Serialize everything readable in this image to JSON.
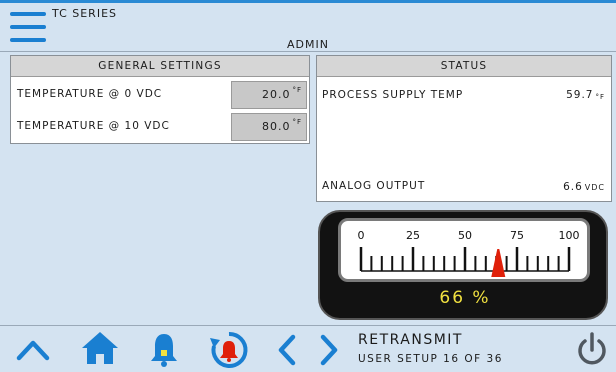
{
  "header": {
    "series_label": "TC SERIES",
    "user_level": "ADMIN",
    "menu_icon": "hamburger-menu-icon"
  },
  "general_settings": {
    "title": "GENERAL SETTINGS",
    "rows": [
      {
        "label": "TEMPERATURE @ 0 VDC",
        "value": "20.0",
        "unit": "°F"
      },
      {
        "label": "TEMPERATURE @ 10 VDC",
        "value": "80.0",
        "unit": "°F"
      }
    ]
  },
  "status": {
    "title": "STATUS",
    "rows": [
      {
        "label": "PROCESS SUPPLY TEMP",
        "value": "59.7",
        "unit": "°F"
      },
      {
        "label": "ANALOG OUTPUT",
        "value": "6.6",
        "unit": "VDC"
      }
    ]
  },
  "gauge": {
    "ticks": [
      "0",
      "25",
      "50",
      "75",
      "100"
    ],
    "value": 66,
    "readout": "66 %",
    "needle_color": "#e0200a",
    "readout_color": "#f0e040"
  },
  "footer": {
    "title": "RETRANSMIT",
    "subtitle": "USER SETUP 16 OF 36",
    "icons": [
      "chevron-up-icon",
      "home-icon",
      "bell-icon",
      "alarm-history-icon",
      "chevron-left-icon",
      "chevron-right-icon",
      "power-icon"
    ],
    "accent_color": "#1a7fd1"
  }
}
